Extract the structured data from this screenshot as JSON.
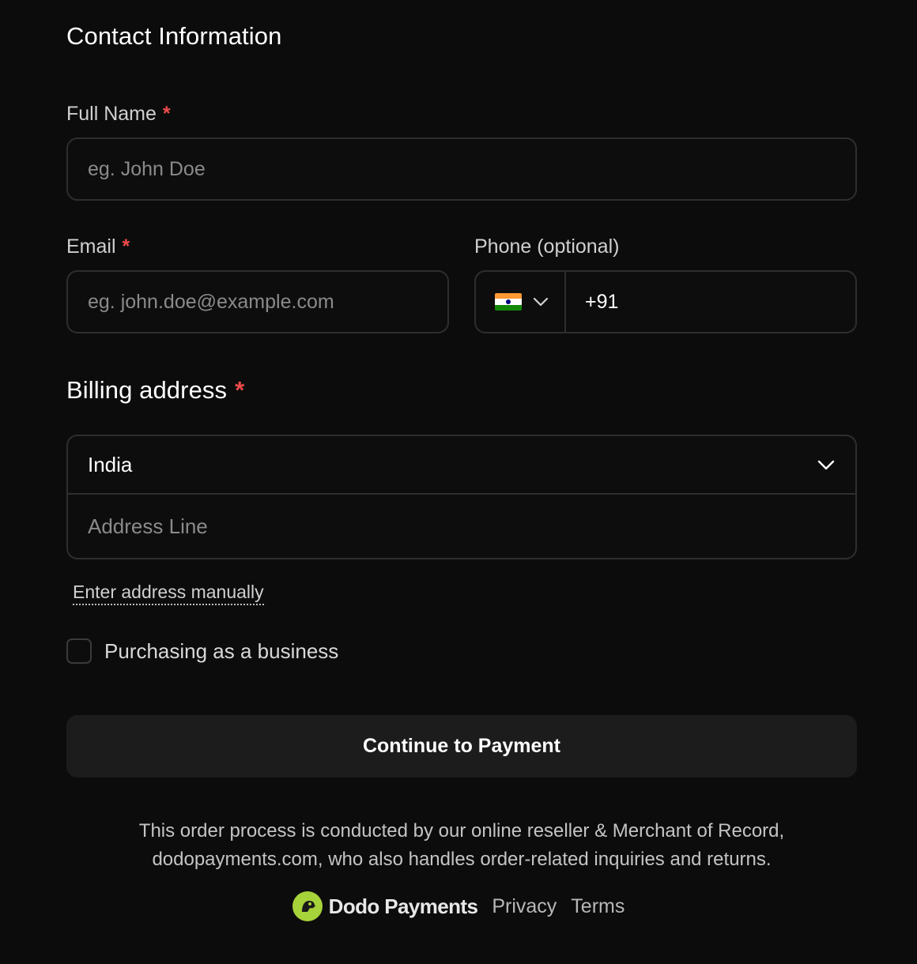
{
  "contact": {
    "title": "Contact Information",
    "full_name_label": "Full Name",
    "full_name_placeholder": "eg. John Doe",
    "email_label": "Email",
    "email_placeholder": "eg. john.doe@example.com",
    "phone_label": "Phone (optional)",
    "phone_country_flag": "india-flag-icon",
    "phone_value": "+91",
    "required_marker": "*"
  },
  "billing": {
    "title": "Billing address",
    "required_marker": "*",
    "country_selected": "India",
    "address_placeholder": "Address Line",
    "manual_link": "Enter address manually",
    "business_checkbox_label": "Purchasing as a business",
    "business_checked": false
  },
  "cta": {
    "label": "Continue to Payment"
  },
  "disclaimer": {
    "line1": "This order process is conducted by our online reseller & Merchant of Record,",
    "line2": "dodopayments.com, who also handles order-related inquiries and returns."
  },
  "footer": {
    "brand": "Dodo Payments",
    "links": [
      "Privacy",
      "Terms"
    ]
  },
  "colors": {
    "background": "#0c0c0c",
    "required": "#ef4b4b",
    "button_bg": "#1c1c1c",
    "brand_accent": "#a6d23a"
  }
}
